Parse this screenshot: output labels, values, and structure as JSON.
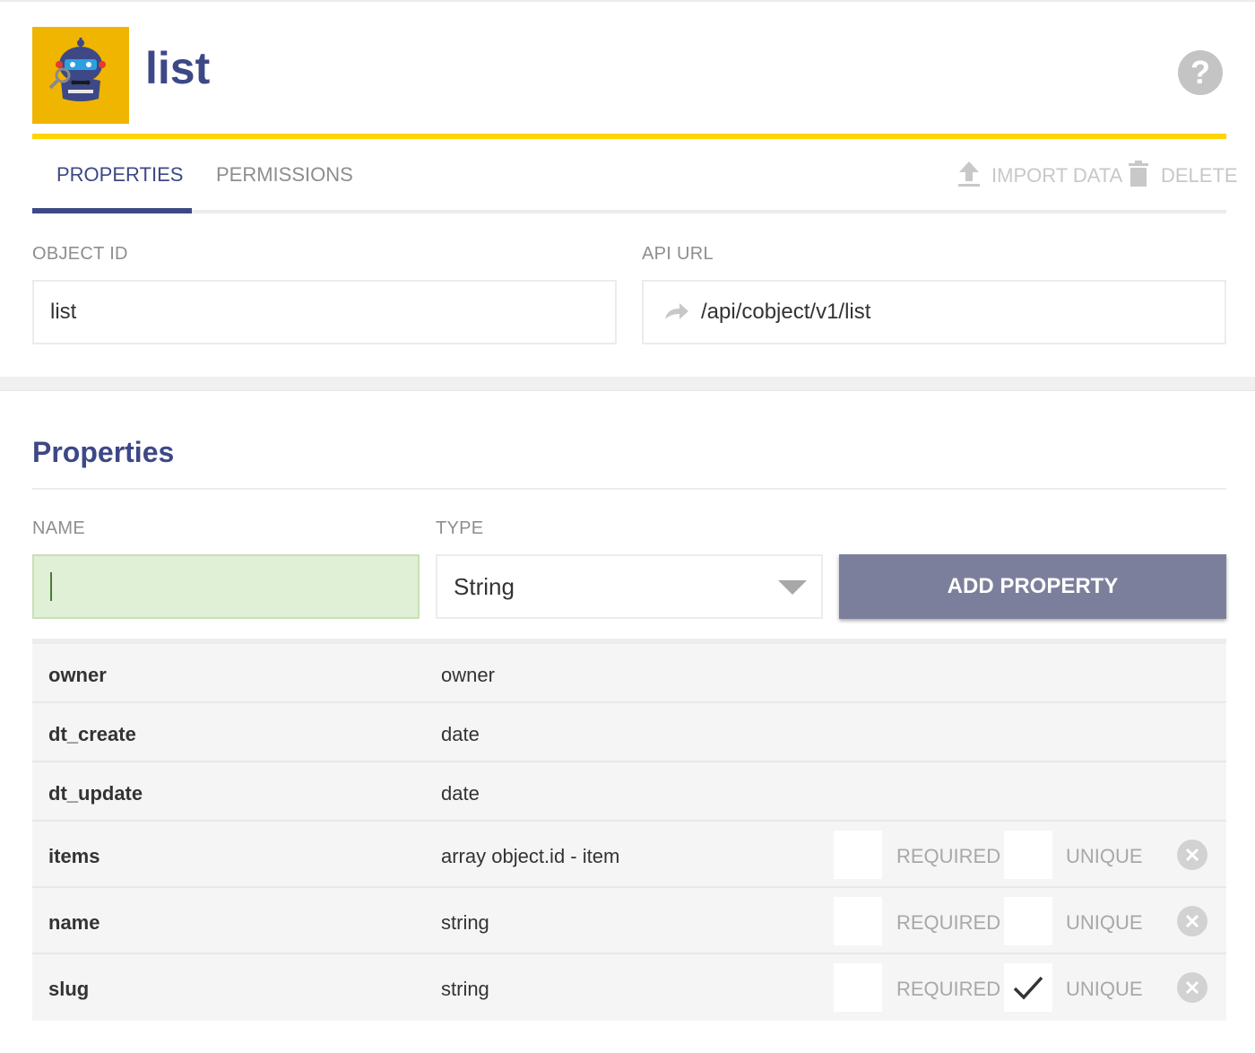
{
  "header": {
    "title": "list",
    "logo_icon": "robot-mascot-icon",
    "help_icon": "help-circle-icon",
    "accent_color": "#ffd400",
    "brand_color": "#3d4886"
  },
  "tabs": [
    {
      "label": "PROPERTIES",
      "active": true
    },
    {
      "label": "PERMISSIONS",
      "active": false
    }
  ],
  "actions": {
    "import_label": "IMPORT DATA",
    "import_icon": "upload-icon",
    "delete_label": "DELETE",
    "delete_icon": "trash-icon"
  },
  "object": {
    "id_label": "OBJECT ID",
    "id_value": "list",
    "api_label": "API URL",
    "api_value": "/api/cobject/v1/list",
    "api_icon": "share-arrow-icon"
  },
  "properties": {
    "title": "Properties",
    "name_label": "NAME",
    "name_value": "",
    "type_label": "TYPE",
    "type_value": "String",
    "add_button": "ADD PROPERTY",
    "required_label": "REQUIRED",
    "unique_label": "UNIQUE",
    "rows": [
      {
        "name": "owner",
        "type": "owner",
        "editable": false
      },
      {
        "name": "dt_create",
        "type": "date",
        "editable": false
      },
      {
        "name": "dt_update",
        "type": "date",
        "editable": false
      },
      {
        "name": "items",
        "type": "array object.id - item",
        "editable": true,
        "required": false,
        "unique": false
      },
      {
        "name": "name",
        "type": "string",
        "editable": true,
        "required": false,
        "unique": false
      },
      {
        "name": "slug",
        "type": "string",
        "editable": true,
        "required": false,
        "unique": true
      }
    ]
  }
}
